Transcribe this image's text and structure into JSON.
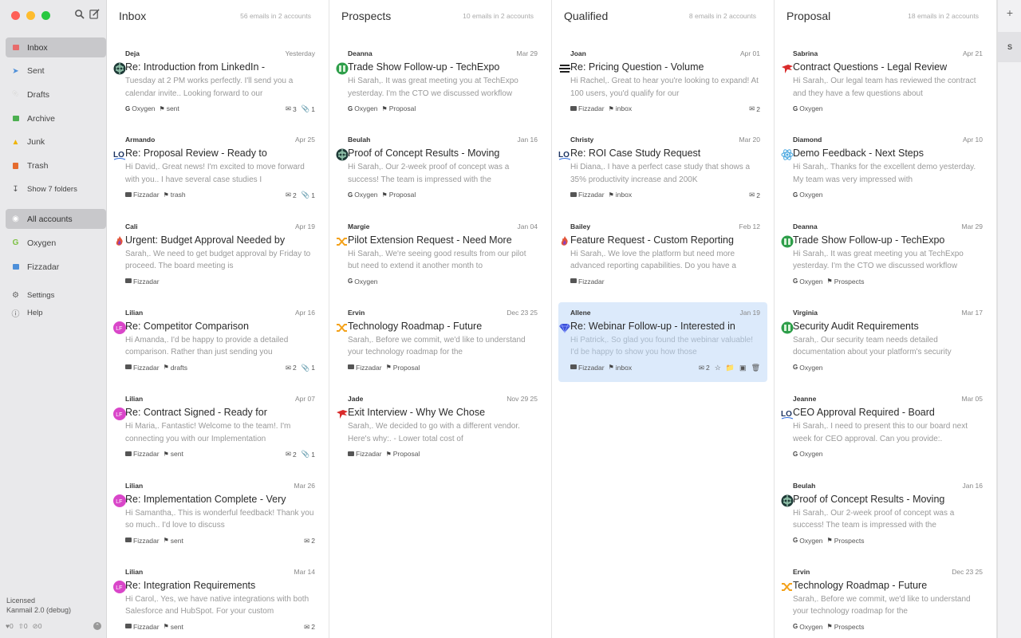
{
  "sidebar": {
    "mailboxes": [
      {
        "label": "Inbox",
        "icon": "inbox-icon",
        "color": "#e76b6b",
        "active": true
      },
      {
        "label": "Sent",
        "icon": "send-icon",
        "color": "#4d8fd9"
      },
      {
        "label": "Drafts",
        "icon": "pencil-icon",
        "color": "#ffffff"
      },
      {
        "label": "Archive",
        "icon": "archive-icon",
        "color": "#4caf50"
      },
      {
        "label": "Junk",
        "icon": "warning-icon",
        "color": "#f0b400"
      },
      {
        "label": "Trash",
        "icon": "trash-icon",
        "color": "#e56c2f"
      }
    ],
    "show_folders": "Show 7 folders",
    "accounts": [
      {
        "label": "All accounts",
        "icon": "globe-icon",
        "active": true
      },
      {
        "label": "Oxygen",
        "icon": "google-icon",
        "color": "#7cc142"
      },
      {
        "label": "Fizzadar",
        "icon": "mail-icon",
        "color": "#4d8fd9"
      }
    ],
    "settings": "Settings",
    "help": "Help",
    "footer": {
      "line1": "Licensed",
      "line2": "Kanmail 2.0 (debug)",
      "stat1": "0",
      "stat2": "0",
      "stat3": "0"
    }
  },
  "rail": {
    "add": "+",
    "account_initial": "S"
  },
  "columns": [
    {
      "title": "Inbox",
      "count": "56 emails in 2 accounts",
      "cards": [
        {
          "sender": "Deja",
          "date": "Yesterday",
          "logo": "globe-green-logo",
          "subject": "Re: Introduction from LinkedIn -",
          "preview": "Tuesday at 2 PM works perfectly. I'll send you a calendar invite.. Looking forward to our",
          "tags": [
            {
              "mark": "G",
              "label": "Oxygen"
            },
            {
              "mark": "tag",
              "label": "sent"
            }
          ],
          "replies": "3",
          "attachments": "1"
        },
        {
          "sender": "Armando",
          "date": "Apr 25",
          "logo": "lo-logo",
          "subject": "Re: Proposal Review - Ready to",
          "preview": "Hi David,. Great news! I'm excited to move forward with you.. I have several case studies I",
          "tags": [
            {
              "mark": "mail",
              "label": "Fizzadar"
            },
            {
              "mark": "tag",
              "label": "trash"
            }
          ],
          "replies": "2",
          "attachments": "1"
        },
        {
          "sender": "Cali",
          "date": "Apr 19",
          "logo": "flame-logo",
          "subject": "Urgent: Budget Approval Needed by",
          "preview": "Sarah,. We need to get budget approval by Friday to proceed. The board meeting is",
          "tags": [
            {
              "mark": "mail",
              "label": "Fizzadar"
            }
          ],
          "replies": "",
          "attachments": ""
        },
        {
          "sender": "Lilian",
          "date": "Apr 16",
          "logo": "lf-avatar",
          "subject": "Re: Competitor Comparison",
          "preview": "Hi Amanda,. I'd be happy to provide a detailed comparison. Rather than just sending you",
          "tags": [
            {
              "mark": "mail",
              "label": "Fizzadar"
            },
            {
              "mark": "tag",
              "label": "drafts"
            }
          ],
          "replies": "2",
          "attachments": "1"
        },
        {
          "sender": "Lilian",
          "date": "Apr 07",
          "logo": "lf-avatar",
          "subject": "Re: Contract Signed - Ready for",
          "preview": "Hi Maria,. Fantastic! Welcome to the team!. I'm connecting you with our Implementation",
          "tags": [
            {
              "mark": "mail",
              "label": "Fizzadar"
            },
            {
              "mark": "tag",
              "label": "sent"
            }
          ],
          "replies": "2",
          "attachments": "1"
        },
        {
          "sender": "Lilian",
          "date": "Mar 26",
          "logo": "lf-avatar",
          "subject": "Re: Implementation Complete - Very",
          "preview": "Hi Samantha,. This is wonderful feedback! Thank you so much.. I'd love to discuss",
          "tags": [
            {
              "mark": "mail",
              "label": "Fizzadar"
            },
            {
              "mark": "tag",
              "label": "sent"
            }
          ],
          "replies": "2",
          "attachments": ""
        },
        {
          "sender": "Lilian",
          "date": "Mar 14",
          "logo": "lf-avatar",
          "subject": "Re: Integration Requirements",
          "preview": "Hi Carol,. Yes, we have native integrations with both Salesforce and HubSpot. For your custom",
          "tags": [
            {
              "mark": "mail",
              "label": "Fizzadar"
            },
            {
              "mark": "tag",
              "label": "sent"
            }
          ],
          "replies": "2",
          "attachments": ""
        }
      ]
    },
    {
      "title": "Prospects",
      "count": "10 emails in 2 accounts",
      "cards": [
        {
          "sender": "Deanna",
          "date": "Mar 29",
          "logo": "green-grid-logo",
          "subject": "Trade Show Follow-up - TechExpo",
          "preview": "Hi Sarah,. It was great meeting you at TechExpo yesterday. I'm the CTO we discussed workflow",
          "tags": [
            {
              "mark": "G",
              "label": "Oxygen"
            },
            {
              "mark": "tag",
              "label": "Proposal"
            }
          ],
          "replies": "",
          "attachments": ""
        },
        {
          "sender": "Beulah",
          "date": "Jan 16",
          "logo": "globe-green-logo",
          "subject": "Proof of Concept Results - Moving",
          "preview": "Hi Sarah,. Our 2-week proof of concept was a success! The team is impressed with the",
          "tags": [
            {
              "mark": "G",
              "label": "Oxygen"
            },
            {
              "mark": "tag",
              "label": "Proposal"
            }
          ],
          "replies": "",
          "attachments": ""
        },
        {
          "sender": "Margie",
          "date": "Jan 04",
          "logo": "shuffle-logo",
          "subject": "Pilot Extension Request - Need More",
          "preview": "Hi Sarah,. We're seeing good results from our pilot but need to extend it another month to",
          "tags": [
            {
              "mark": "G",
              "label": "Oxygen"
            }
          ],
          "replies": "",
          "attachments": ""
        },
        {
          "sender": "Ervin",
          "date": "Dec 23 25",
          "logo": "shuffle-logo",
          "subject": "Technology Roadmap - Future",
          "preview": "Sarah,. Before we commit, we'd like to understand your technology roadmap for the",
          "tags": [
            {
              "mark": "mail",
              "label": "Fizzadar"
            },
            {
              "mark": "tag",
              "label": "Proposal"
            }
          ],
          "replies": "",
          "attachments": ""
        },
        {
          "sender": "Jade",
          "date": "Nov 29 25",
          "logo": "red-bird-logo",
          "subject": "Exit Interview - Why We Chose",
          "preview": "Sarah,. We decided to go with a different vendor. Here's why:. - Lower total cost of",
          "tags": [
            {
              "mark": "mail",
              "label": "Fizzadar"
            },
            {
              "mark": "tag",
              "label": "Proposal"
            }
          ],
          "replies": "",
          "attachments": ""
        }
      ]
    },
    {
      "title": "Qualified",
      "count": "8 emails in 2 accounts",
      "cards": [
        {
          "sender": "Joan",
          "date": "Apr 01",
          "logo": "stripes-logo",
          "subject": "Re: Pricing Question - Volume",
          "preview": "Hi Rachel,. Great to hear you're looking to expand! At 100 users, you'd qualify for our",
          "tags": [
            {
              "mark": "mail",
              "label": "Fizzadar"
            },
            {
              "mark": "tag",
              "label": "inbox"
            }
          ],
          "replies": "2",
          "attachments": ""
        },
        {
          "sender": "Christy",
          "date": "Mar 20",
          "logo": "lo-logo",
          "subject": "Re: ROI Case Study Request",
          "preview": "Hi Diana,. I have a perfect case study that shows a 35% productivity increase and 200K",
          "tags": [
            {
              "mark": "mail",
              "label": "Fizzadar"
            },
            {
              "mark": "tag",
              "label": "inbox"
            }
          ],
          "replies": "2",
          "attachments": ""
        },
        {
          "sender": "Bailey",
          "date": "Feb 12",
          "logo": "flame-logo",
          "subject": "Feature Request - Custom Reporting",
          "preview": "Hi Sarah,. We love the platform but need more advanced reporting capabilities. Do you have a",
          "tags": [
            {
              "mark": "mail",
              "label": "Fizzadar"
            }
          ],
          "replies": "",
          "attachments": ""
        },
        {
          "sender": "Allene",
          "date": "Jan 19",
          "logo": "blue-gem-logo",
          "subject": "Re: Webinar Follow-up - Interested in",
          "preview": "Hi Patrick,. So glad you found the webinar valuable! I'd be happy to show you how those",
          "tags": [
            {
              "mark": "mail",
              "label": "Fizzadar"
            },
            {
              "mark": "tag",
              "label": "inbox"
            }
          ],
          "replies": "2",
          "attachments": "",
          "selected": true
        }
      ]
    },
    {
      "title": "Proposal",
      "count": "18 emails in 2 accounts",
      "cards": [
        {
          "sender": "Sabrina",
          "date": "Apr 21",
          "logo": "red-bird-logo",
          "subject": "Contract Questions - Legal Review",
          "preview": "Hi Sarah,. Our legal team has reviewed the contract and they have a few questions about",
          "tags": [
            {
              "mark": "G",
              "label": "Oxygen"
            }
          ],
          "replies": "",
          "attachments": ""
        },
        {
          "sender": "Diamond",
          "date": "Apr 10",
          "logo": "atom-logo",
          "subject": "Demo Feedback - Next Steps",
          "preview": "Hi Sarah,. Thanks for the excellent demo yesterday. My team was very impressed with",
          "tags": [
            {
              "mark": "G",
              "label": "Oxygen"
            }
          ],
          "replies": "",
          "attachments": ""
        },
        {
          "sender": "Deanna",
          "date": "Mar 29",
          "logo": "green-grid-logo",
          "subject": "Trade Show Follow-up - TechExpo",
          "preview": "Hi Sarah,. It was great meeting you at TechExpo yesterday. I'm the CTO we discussed workflow",
          "tags": [
            {
              "mark": "G",
              "label": "Oxygen"
            },
            {
              "mark": "tag",
              "label": "Prospects"
            }
          ],
          "replies": "",
          "attachments": ""
        },
        {
          "sender": "Virginia",
          "date": "Mar 17",
          "logo": "green-grid-logo",
          "subject": "Security Audit Requirements",
          "preview": "Sarah,. Our security team needs detailed documentation about your platform's security",
          "tags": [
            {
              "mark": "G",
              "label": "Oxygen"
            }
          ],
          "replies": "",
          "attachments": ""
        },
        {
          "sender": "Jeanne",
          "date": "Mar 05",
          "logo": "lo-logo",
          "subject": "CEO Approval Required - Board",
          "preview": "Hi Sarah,. I need to present this to our board next week for CEO approval. Can you provide:.",
          "tags": [
            {
              "mark": "G",
              "label": "Oxygen"
            }
          ],
          "replies": "",
          "attachments": ""
        },
        {
          "sender": "Beulah",
          "date": "Jan 16",
          "logo": "globe-green-logo",
          "subject": "Proof of Concept Results - Moving",
          "preview": "Hi Sarah,. Our 2-week proof of concept was a success! The team is impressed with the",
          "tags": [
            {
              "mark": "G",
              "label": "Oxygen"
            },
            {
              "mark": "tag",
              "label": "Prospects"
            }
          ],
          "replies": "",
          "attachments": ""
        },
        {
          "sender": "Ervin",
          "date": "Dec 23 25",
          "logo": "shuffle-logo",
          "subject": "Technology Roadmap - Future",
          "preview": "Sarah,. Before we commit, we'd like to understand your technology roadmap for the",
          "tags": [
            {
              "mark": "G",
              "label": "Oxygen"
            },
            {
              "mark": "tag",
              "label": "Prospects"
            }
          ],
          "replies": "",
          "attachments": ""
        }
      ]
    }
  ]
}
